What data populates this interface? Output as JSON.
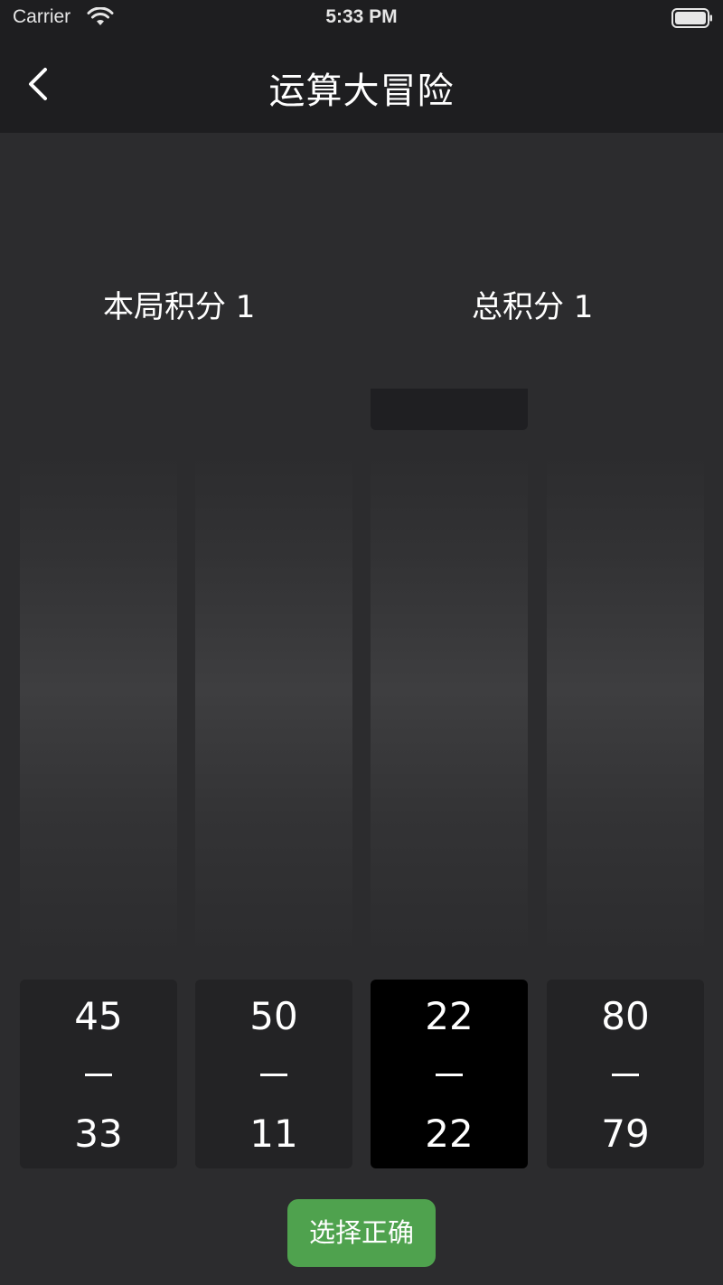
{
  "status_bar": {
    "carrier": "Carrier",
    "time": "5:33 PM"
  },
  "nav": {
    "title": "运算大冒险",
    "back_icon": "chevron-left-icon"
  },
  "scores": {
    "round_label": "本局积分 1",
    "total_label": "总积分 1"
  },
  "cards": [
    {
      "top": "45",
      "operator": "—",
      "bottom": "33",
      "selected": false
    },
    {
      "top": "50",
      "operator": "—",
      "bottom": "11",
      "selected": false
    },
    {
      "top": "22",
      "operator": "—",
      "bottom": "22",
      "selected": true
    },
    {
      "top": "80",
      "operator": "—",
      "bottom": "79",
      "selected": false
    }
  ],
  "confirm_button": {
    "label": "选择正确",
    "color": "#4fa24e"
  },
  "colors": {
    "background": "#2c2c2e",
    "bar": "#1e1e20",
    "card": "#232325",
    "card_selected": "#000000"
  }
}
